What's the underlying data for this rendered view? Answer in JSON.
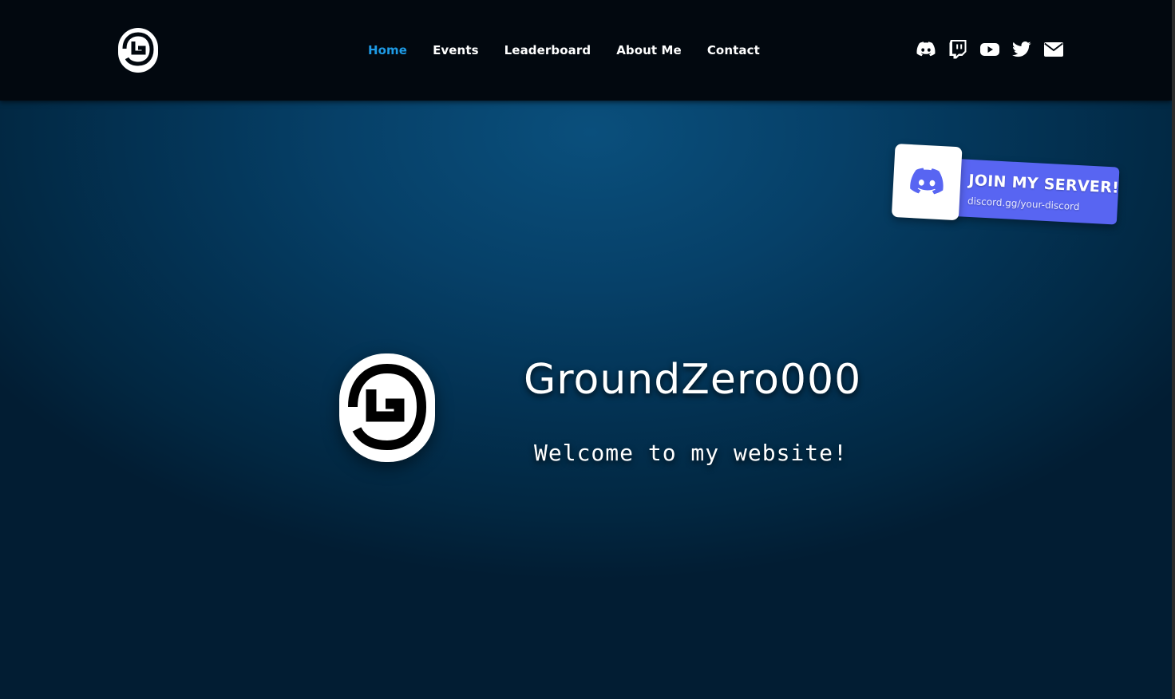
{
  "header": {
    "logo_icon": "swirl-logo-icon",
    "nav": [
      {
        "label": "Home",
        "active": true
      },
      {
        "label": "Events",
        "active": false
      },
      {
        "label": "Leaderboard",
        "active": false
      },
      {
        "label": "About Me",
        "active": false
      },
      {
        "label": "Contact",
        "active": false
      }
    ],
    "socials": [
      {
        "icon": "discord-icon"
      },
      {
        "icon": "twitch-icon"
      },
      {
        "icon": "youtube-icon"
      },
      {
        "icon": "twitter-icon"
      },
      {
        "icon": "email-icon"
      }
    ]
  },
  "hero": {
    "title": "GroundZero000",
    "subtitle": "Welcome to my website!"
  },
  "discord_widget": {
    "heading": "JOIN MY SERVER!",
    "link": "discord.gg/your-discord",
    "icon": "discord-icon"
  },
  "colors": {
    "header_bg": "#02080f",
    "active_nav": "#1e9be6",
    "discord_blurple": "#5865f2",
    "hero_bg": "#064068"
  }
}
